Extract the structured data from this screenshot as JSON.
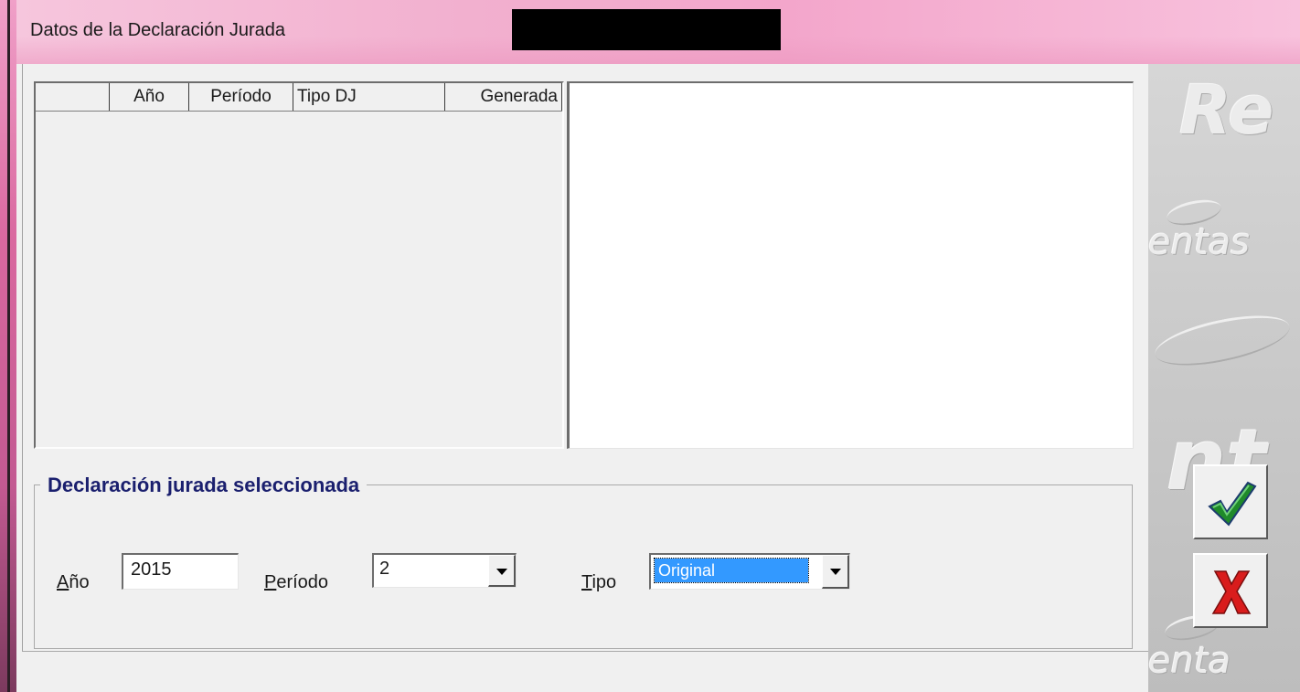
{
  "window": {
    "title": "Datos de la Declaración Jurada"
  },
  "grid": {
    "columns": [
      "",
      "Año",
      "Período",
      "Tipo DJ",
      "Generada"
    ],
    "rows": []
  },
  "selected_group": {
    "title": "Declaración jurada seleccionada",
    "year_label_prefix": "A",
    "year_label_rest": "ño",
    "year_value": "2015",
    "period_label_prefix": "P",
    "period_label_rest": "eríodo",
    "period_value": "2",
    "type_label_prefix": "T",
    "type_label_rest": "ipo",
    "type_value": "Original"
  },
  "sidebar": {
    "watermark_top": "Re",
    "watermark_mid": "entas",
    "watermark_big": "nt",
    "watermark_bottom": "enta"
  },
  "buttons": {
    "accept_icon": "checkmark-icon",
    "cancel_icon": "x-icon"
  },
  "colors": {
    "title_gradient": "#f3a6cb",
    "group_title": "#1a1f6e",
    "selection": "#3399ff",
    "check_green": "#1f8a2a",
    "cancel_red": "#d91c1c"
  }
}
